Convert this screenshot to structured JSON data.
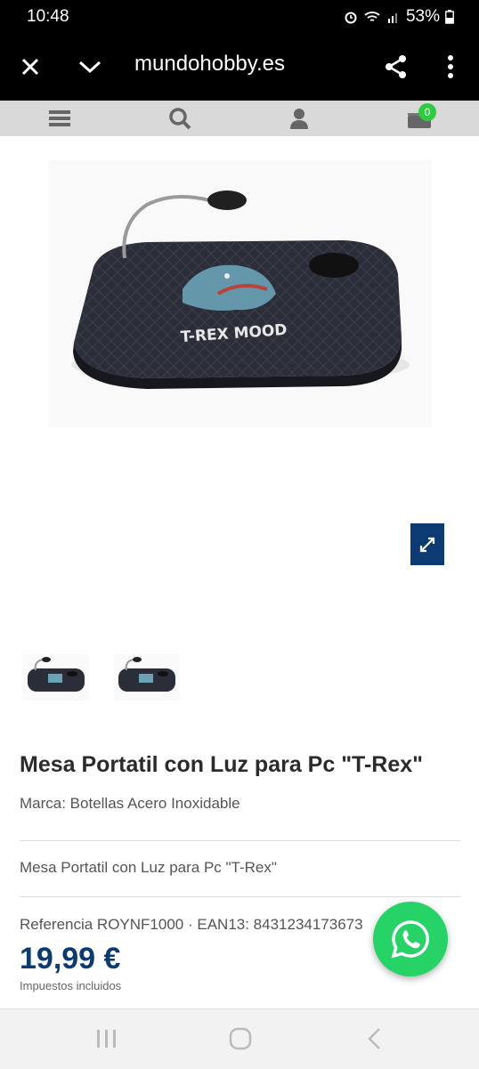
{
  "status": {
    "time": "10:48",
    "battery": "53%"
  },
  "browser": {
    "url": "mundohobby.es"
  },
  "site_nav": {
    "cart_count": "0"
  },
  "product": {
    "image_caption": "T-REX MOOD",
    "title": "Mesa Portatil con Luz para Pc \"T-Rex\"",
    "brand_line": "Marca: Botellas Acero Inoxidable",
    "short_description": "Mesa Portatil con Luz para Pc \"T-Rex\"",
    "reference_line": "Referencia ROYNF1000 · EAN13: 8431234173673",
    "price": "19,99 €",
    "taxes_note": "Impuestos incluidos"
  },
  "colors": {
    "price": "#0b3b72",
    "whatsapp": "#25d366",
    "badge": "#2ecc40"
  }
}
